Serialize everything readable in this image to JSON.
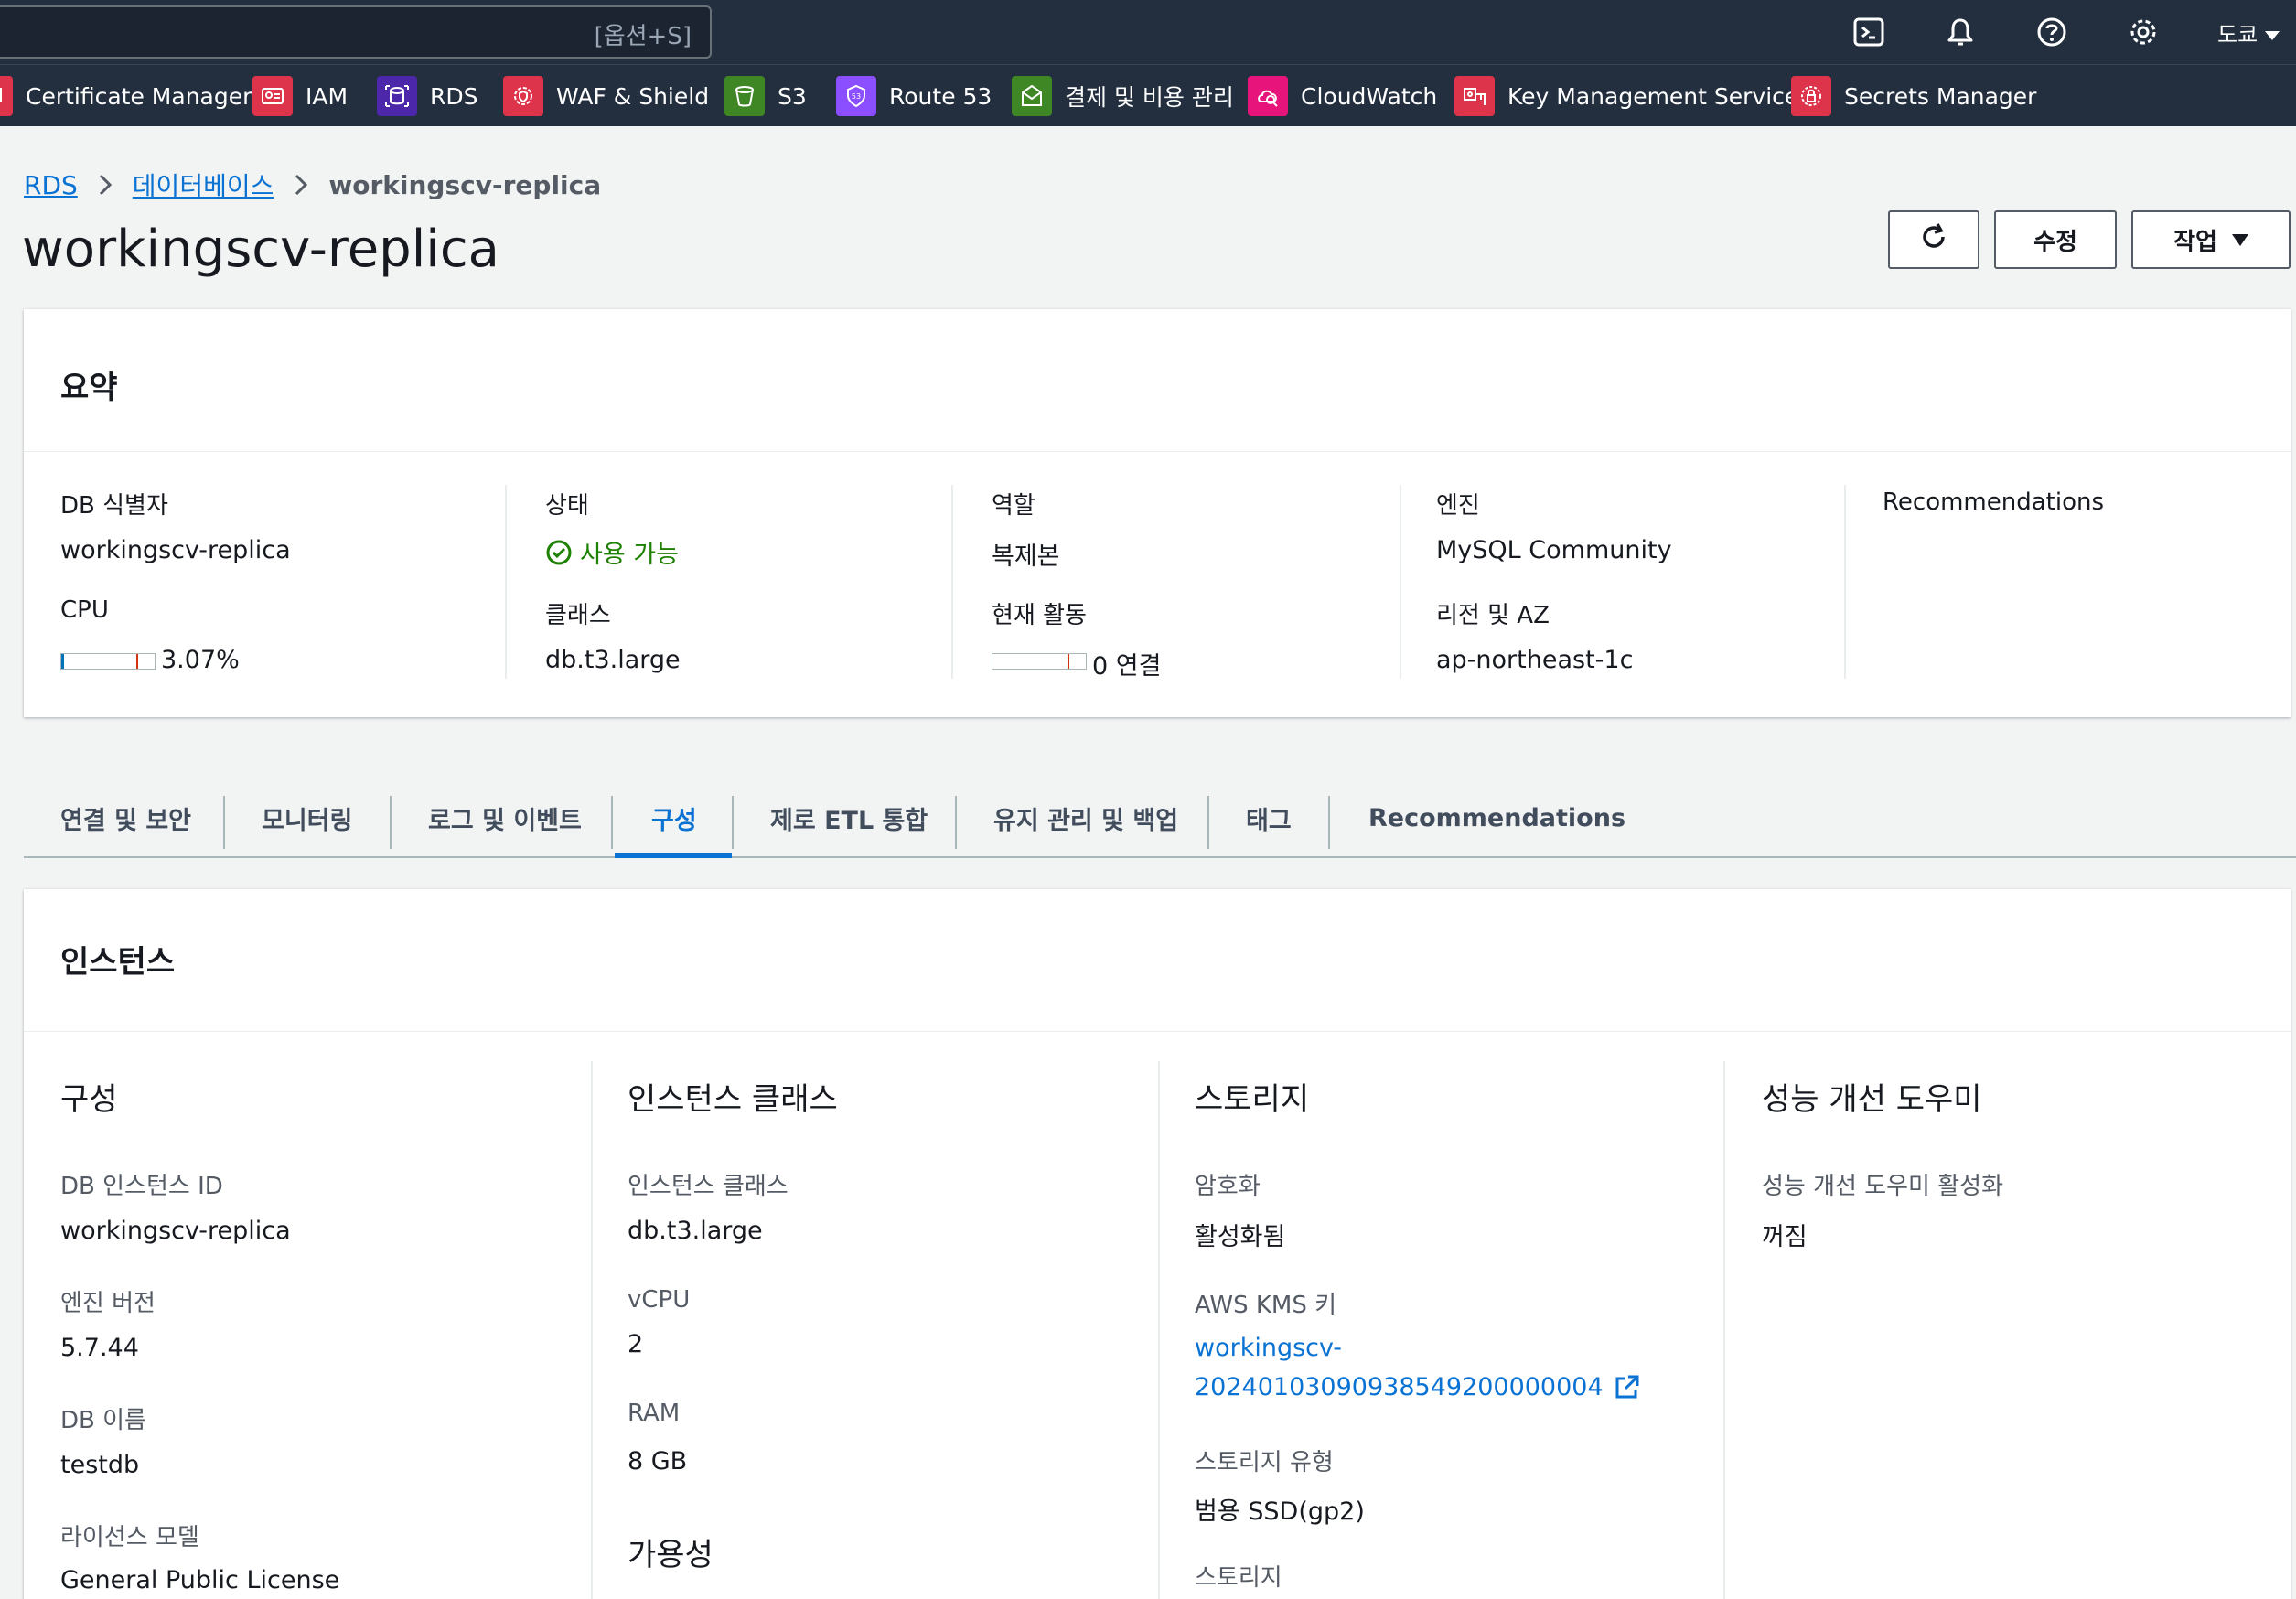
{
  "topbar": {
    "search_hint": "[옵션+S]",
    "region": "도쿄"
  },
  "favorites": [
    {
      "label": "Certificate Manager",
      "color": "#dd344c"
    },
    {
      "label": "IAM",
      "color": "#dd344c"
    },
    {
      "label": "RDS",
      "color": "#4d27aa"
    },
    {
      "label": "WAF & Shield",
      "color": "#dd344c"
    },
    {
      "label": "S3",
      "color": "#3f8624"
    },
    {
      "label": "Route 53",
      "color": "#8c4fff"
    },
    {
      "label": "결제 및 비용 관리",
      "color": "#3f8624"
    },
    {
      "label": "CloudWatch",
      "color": "#e7157b"
    },
    {
      "label": "Key Management Service",
      "color": "#dd344c"
    },
    {
      "label": "Secrets Manager",
      "color": "#dd344c"
    }
  ],
  "breadcrumb": {
    "root": "RDS",
    "parent": "데이터베이스",
    "current": "workingscv-replica"
  },
  "page_title": "workingscv-replica",
  "actions": {
    "modify": "수정",
    "actions": "작업"
  },
  "summary": {
    "title": "요약",
    "db_id_label": "DB 식별자",
    "db_id": "workingscv-replica",
    "cpu_label": "CPU",
    "cpu_value": "3.07%",
    "cpu_fraction": 0.0307,
    "status_label": "상태",
    "status": "사용 가능",
    "class_label": "클래스",
    "class": "db.t3.large",
    "role_label": "역할",
    "role": "복제본",
    "activity_label": "현재 활동",
    "activity": "0 연결",
    "activity_fraction": 0,
    "engine_label": "엔진",
    "engine": "MySQL Community",
    "region_label": "리전 및 AZ",
    "region": "ap-northeast-1c",
    "recommendations": "Recommendations"
  },
  "tabs": [
    {
      "label": "연결 및 보안"
    },
    {
      "label": "모니터링"
    },
    {
      "label": "로그 및 이벤트"
    },
    {
      "label": "구성"
    },
    {
      "label": "제로 ETL 통합"
    },
    {
      "label": "유지 관리 및 백업"
    },
    {
      "label": "태그"
    },
    {
      "label": "Recommendations"
    }
  ],
  "instance": {
    "title": "인스턴스",
    "config": {
      "heading": "구성",
      "id_label": "DB 인스턴스 ID",
      "id": "workingscv-replica",
      "engine_version_label": "엔진 버전",
      "engine_version": "5.7.44",
      "db_name_label": "DB 이름",
      "db_name": "testdb",
      "license_label": "라이선스 모델",
      "license": "General Public License"
    },
    "class": {
      "heading": "인스턴스 클래스",
      "class_label": "인스턴스 클래스",
      "class": "db.t3.large",
      "vcpu_label": "vCPU",
      "vcpu": "2",
      "ram_label": "RAM",
      "ram": "8 GB",
      "availability_heading": "가용성"
    },
    "storage": {
      "heading": "스토리지",
      "encryption_label": "암호화",
      "encryption": "활성화됨",
      "kms_label": "AWS KMS 키",
      "kms_line1": "workingscv-",
      "kms_line2": "20240103090938549200000004",
      "type_label": "스토리지 유형",
      "type": "범용 SSD(gp2)",
      "storage_label": "스토리지"
    },
    "perf": {
      "heading": "성능 개선 도우미",
      "enabled_label": "성능 개선 도우미 활성화",
      "enabled": "꺼짐"
    }
  }
}
